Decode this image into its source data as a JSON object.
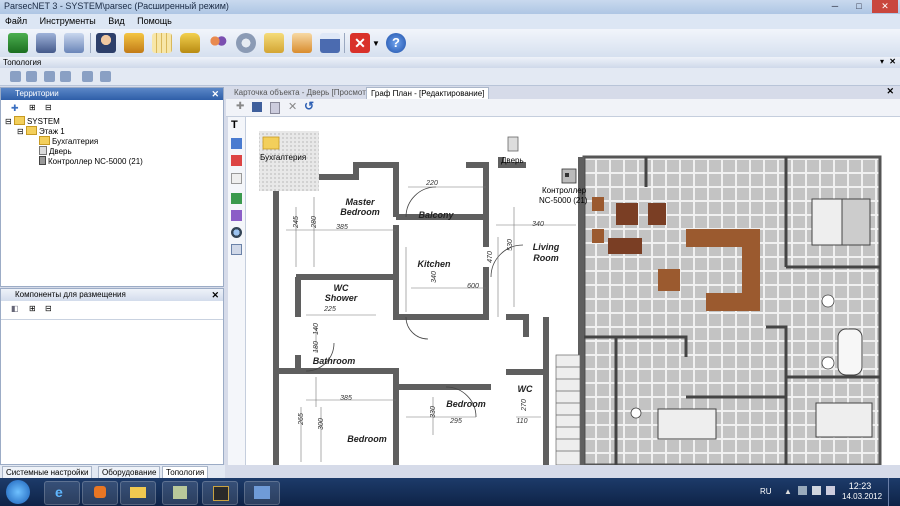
{
  "window": {
    "title": "ParsecNET 3 - SYSTEM\\parsec (Расширенный режим)",
    "controls": [
      "─",
      "□",
      "✕"
    ]
  },
  "menu": [
    "Файл",
    "Инструменты",
    "Вид",
    "Помощь"
  ],
  "toolbar": {
    "icons": [
      "network-card-icon",
      "building-icon",
      "list-icon",
      "user-icon",
      "home-icon",
      "calendar-grid-icon",
      "lock-icon",
      "users-icon",
      "gear-icon",
      "id-card-icon",
      "schedule-icon",
      "calendar-icon",
      "exit-icon",
      "help-icon"
    ]
  },
  "topology": {
    "title": "Топология"
  },
  "territories": {
    "title": "Территории",
    "tree": [
      {
        "label": "SYSTEM",
        "level": 0,
        "type": "folder"
      },
      {
        "label": "Этаж 1",
        "level": 1,
        "type": "folder"
      },
      {
        "label": "Бухгалтерия",
        "level": 2,
        "type": "folder"
      },
      {
        "label": "Дверь",
        "level": 2,
        "type": "door"
      },
      {
        "label": "Контроллер NC-5000 (21)",
        "level": 2,
        "type": "controller"
      }
    ]
  },
  "components": {
    "title": "Компоненты для размещения"
  },
  "bottom_tabs": [
    "Системные настройки",
    "Оборудование",
    "Топология"
  ],
  "doc_tabs": [
    "Карточка объекта - Дверь [Просмотр]",
    "Граф План - [Редактирование]"
  ],
  "plan": {
    "placed": {
      "folder": "Бухгалтерия",
      "door": "Дверь",
      "controller_line1": "Контроллер",
      "controller_line2": "NC-5000 (21)"
    },
    "rooms": [
      "Master Bedroom",
      "Balcony",
      "Kitchen",
      "Living Room",
      "WC Shower",
      "Bathroom",
      "Bedroom",
      "Bedroom",
      "WC"
    ],
    "room_lines": {
      "master1": "Master",
      "master2": "Bedroom",
      "living1": "Living",
      "living2": "Room",
      "wc1": "WC",
      "wc2": "Shower"
    },
    "dims": [
      "220",
      "245",
      "280",
      "385",
      "340",
      "470",
      "530",
      "340",
      "600",
      "225",
      "140",
      "180",
      "385",
      "265",
      "300",
      "330",
      "295",
      "270",
      "110"
    ]
  },
  "taskbar": {
    "lang": "RU",
    "time": "12:23",
    "date": "14.03.2012"
  }
}
